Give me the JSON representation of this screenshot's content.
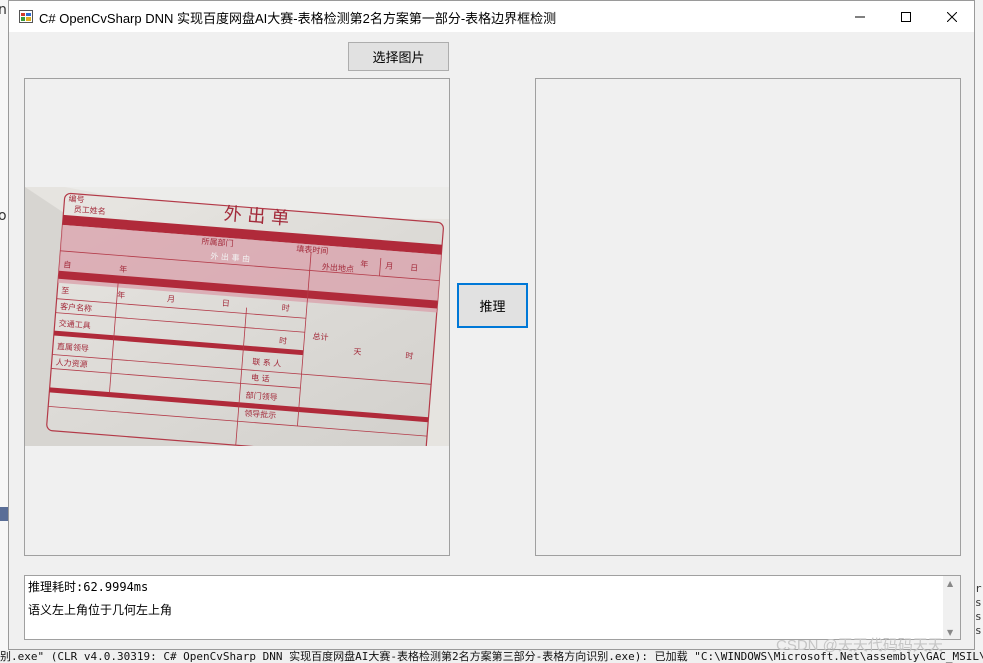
{
  "window": {
    "title": "C# OpenCvSharp DNN 实现百度网盘AI大赛-表格检测第2名方案第一部分-表格边界框检测"
  },
  "buttons": {
    "select_image": "选择图片",
    "infer": "推理"
  },
  "document": {
    "title": "外 出 单",
    "serial_label": "编号",
    "employee_name": "员工姓名",
    "department": "所属部门",
    "fill_time": "填表时间",
    "year": "年",
    "month": "月",
    "day": "日",
    "reason": "外 出 事 由",
    "location": "外出地点",
    "from": "自",
    "to": "至",
    "hour": "时",
    "client": "客户名称",
    "transport": "交通工具",
    "total": "总计",
    "days": "天",
    "supervisor": "直属领导",
    "contact": "联 系 人",
    "phone": "电 话",
    "hr": "人力资源",
    "dept_leader": "部门领导",
    "leader_approval": "领导批示"
  },
  "log": {
    "time_line": "推理耗时:62.9994ms",
    "result_line": "语义左上角位于几何左上角"
  },
  "background": {
    "bottom_text": "别.exe\" (CLR v4.0.30319: C# OpenCvSharp DNN 实现百度网盘AI大赛-表格检测第2名方案第三部分-表格方向识别.exe): 已加载 \"C:\\WINDOWS\\Microsoft.Net\\assembly\\GAC_MSIL\\Syst",
    "watermark": "CSDN @天天代码码天天"
  }
}
